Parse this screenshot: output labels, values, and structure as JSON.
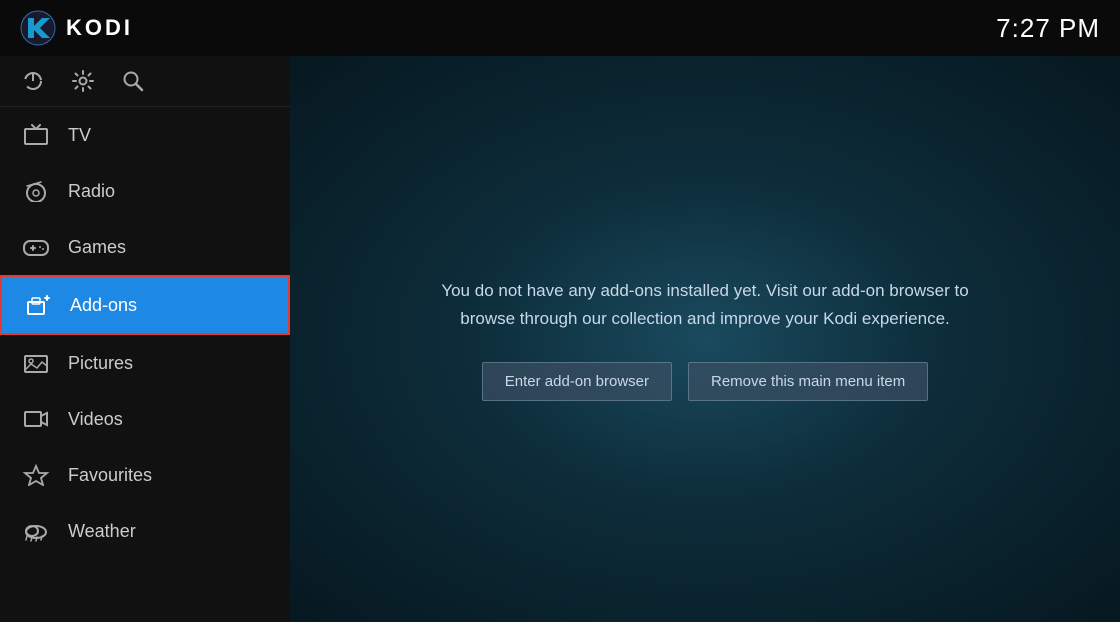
{
  "topbar": {
    "title": "KODI",
    "clock": "7:27 PM"
  },
  "sidebar": {
    "icons": [
      {
        "name": "power-icon",
        "symbol": "⏻"
      },
      {
        "name": "settings-icon",
        "symbol": "⚙"
      },
      {
        "name": "search-icon",
        "symbol": "🔍"
      }
    ],
    "nav_items": [
      {
        "id": "tv",
        "label": "TV",
        "icon": "tv-icon",
        "active": false
      },
      {
        "id": "radio",
        "label": "Radio",
        "icon": "radio-icon",
        "active": false
      },
      {
        "id": "games",
        "label": "Games",
        "icon": "games-icon",
        "active": false
      },
      {
        "id": "addons",
        "label": "Add-ons",
        "icon": "addons-icon",
        "active": true
      },
      {
        "id": "pictures",
        "label": "Pictures",
        "icon": "pictures-icon",
        "active": false
      },
      {
        "id": "videos",
        "label": "Videos",
        "icon": "videos-icon",
        "active": false
      },
      {
        "id": "favourites",
        "label": "Favourites",
        "icon": "favourites-icon",
        "active": false
      },
      {
        "id": "weather",
        "label": "Weather",
        "icon": "weather-icon",
        "active": false
      }
    ]
  },
  "content": {
    "message": "You do not have any add-ons installed yet. Visit our add-on browser to browse through our collection and improve your Kodi experience.",
    "buttons": [
      {
        "id": "enter-addon-browser",
        "label": "Enter add-on browser"
      },
      {
        "id": "remove-menu-item",
        "label": "Remove this main menu item"
      }
    ]
  }
}
